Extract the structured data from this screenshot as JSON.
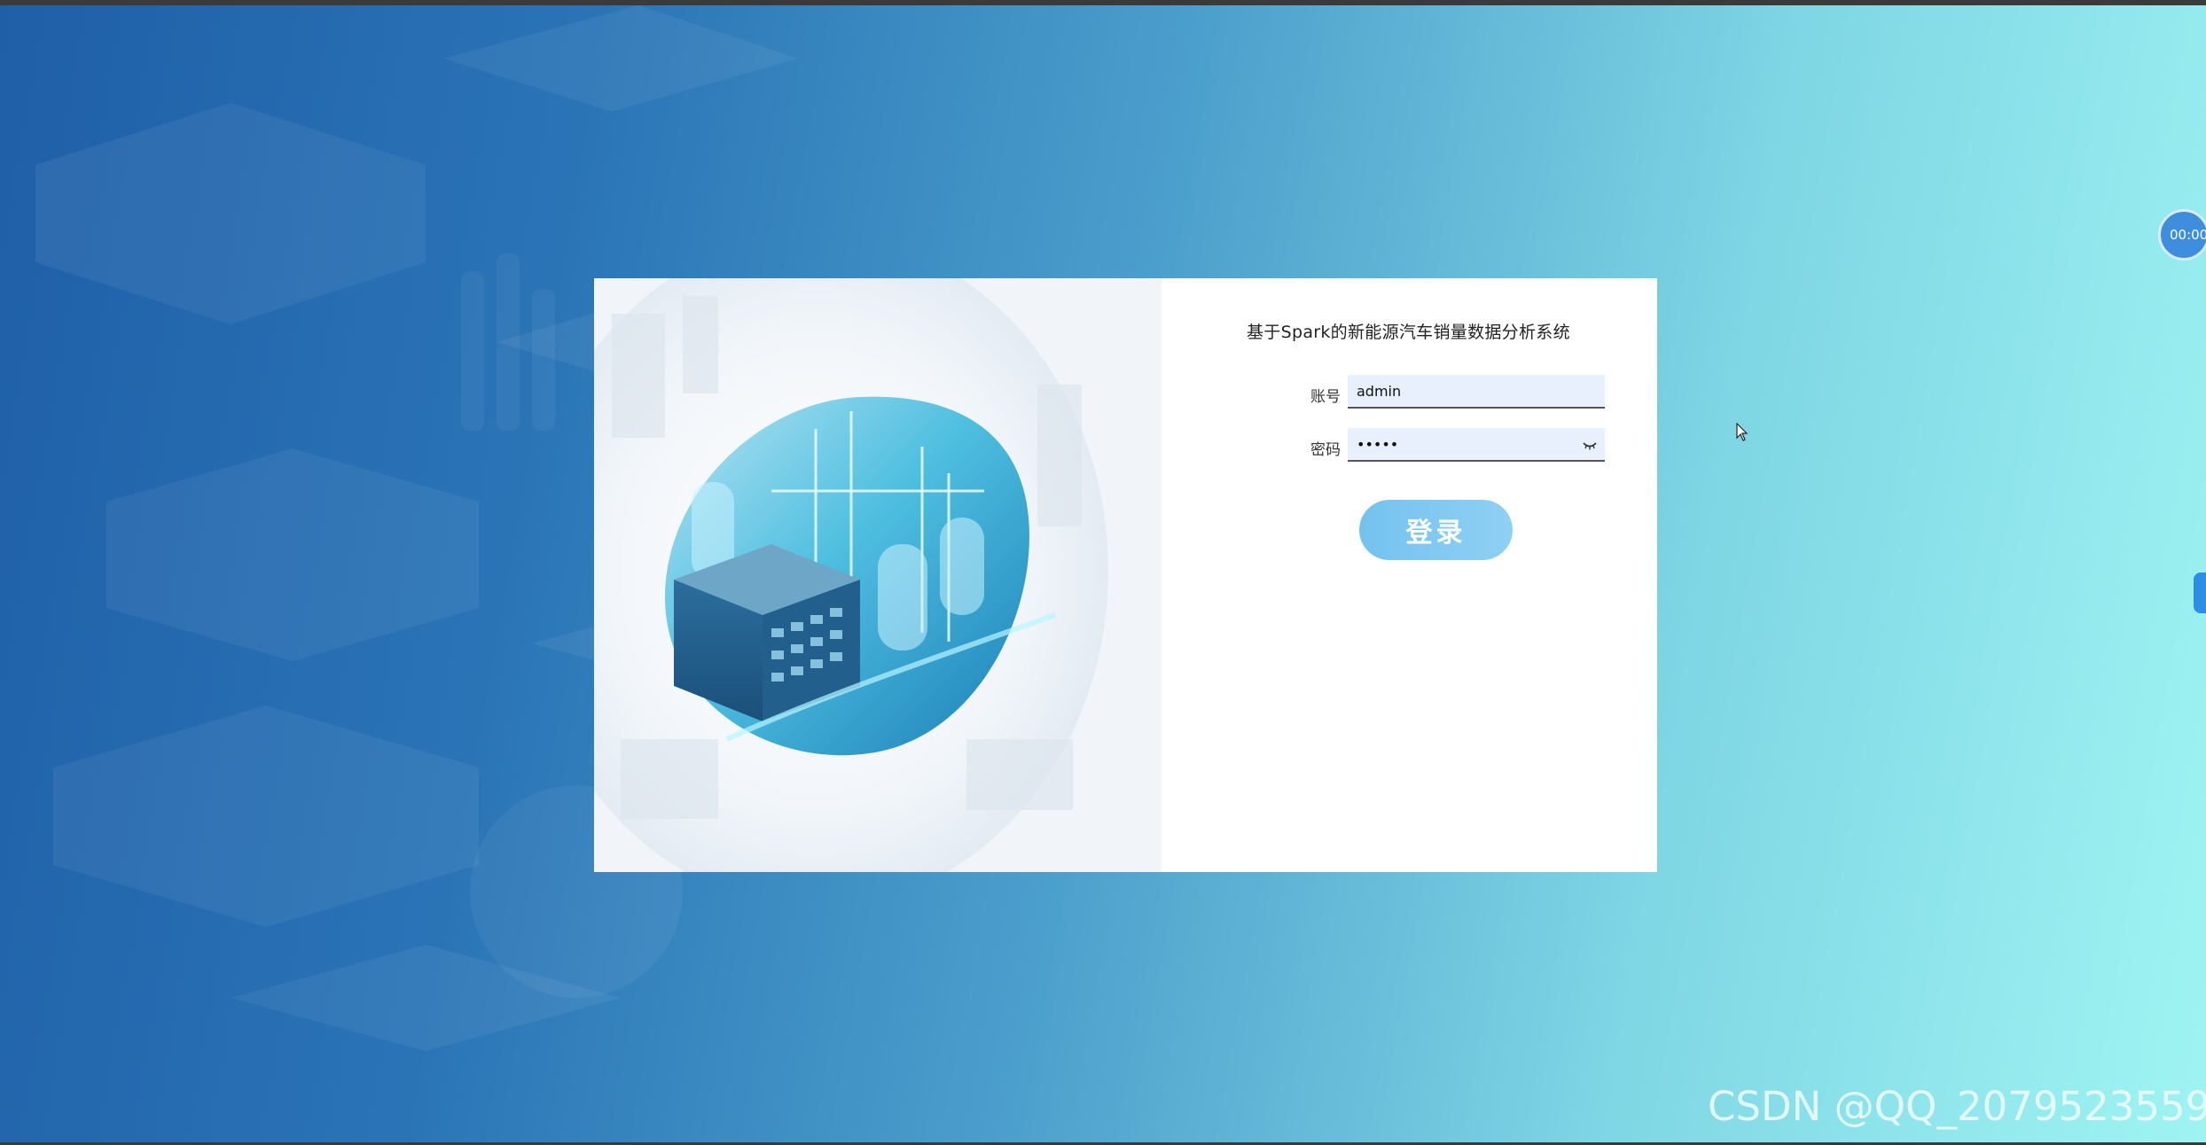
{
  "login": {
    "title": "基于Spark的新能源汽车销量数据分析系统",
    "account_label": "账号",
    "account_value": "admin",
    "password_label": "密码",
    "password_value": "•••••",
    "submit_label": "登录"
  },
  "timer": {
    "value": "00:00"
  },
  "watermark": {
    "text": "CSDN @QQ_2079523559"
  },
  "icons": {
    "password_toggle": "eye-closed-icon",
    "cursor": "mouse-pointer-icon"
  },
  "colors": {
    "button": "#7cc6f2",
    "input_bg": "#e8f0fe",
    "timer_bg": "#3f8ede",
    "side_tab": "#2d8ee6"
  }
}
